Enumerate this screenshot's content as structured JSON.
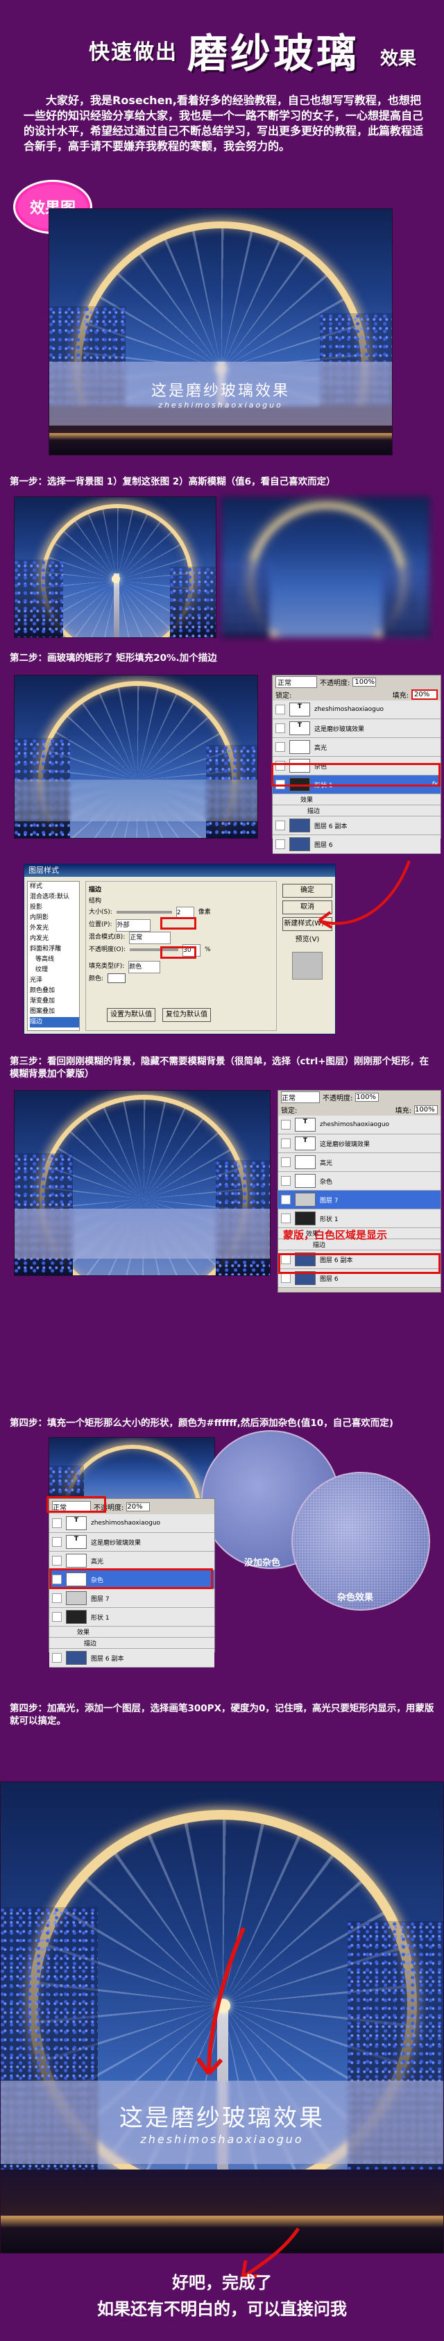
{
  "header": {
    "title_small": "快速做出",
    "title_large": "磨纱玻璃",
    "title_suffix": "效果"
  },
  "intro": "大家好，我是Rosechen,看着好多的经验教程，自己也想写写教程，也想把一些好的知识经验分享给大家，我也是一个一路不断学习的女子，一心想提高自己的设计水平，希望经过通过自己不断总结学习，写出更多更好的教程，此篇教程适合新手，高手请不要嫌弃我教程的寒颤，我会努力的。",
  "badge": "效果图",
  "glass_text": {
    "cn": "这是磨纱玻璃效果",
    "en": "zheshimoshaoxiaoguo"
  },
  "steps": {
    "s1": "第一步：选择一背景图   1）复制这张图   2）高斯模糊（值6，看自己喜欢而定）",
    "s2": "第二步：画玻璃的矩形了   矩形填充20%.加个描边",
    "s3": "第三步：看回刚刚模糊的背景，隐藏不需要模糊背景（很简单，选择（ctrl+图层）刚刚那个矩形，在模糊背景加个蒙版）",
    "s4": "第四步：填充一个矩形那么大小的形状，颜色为#ffffff,然后添加杂色(值10，自己喜欢而定)",
    "s5": "第四步：加高光，添加一个图层，选择画笔300PX，硬度为0，记住哦，高光只要矩形内显示，用蒙版就可以搞定。"
  },
  "layers_panel": {
    "blend_mode": "正常",
    "opacity_label": "不透明度:",
    "opacity_value": "100%",
    "lock_label": "锁定:",
    "fill_label": "填充:",
    "fill_value": "20%",
    "layers": [
      "zheshimoshaoxiaoguo",
      "这是磨纱玻璃效果",
      "高光",
      "杂色",
      "形状 1",
      "效果",
      "描边",
      "图层 6 副本",
      "图层 6"
    ]
  },
  "layer_style": {
    "title": "图层样式",
    "left_items": [
      "样式",
      "混合选项:默认",
      "投影",
      "内阴影",
      "外发光",
      "内发光",
      "斜面和浮雕",
      "等高线",
      "纹理",
      "光泽",
      "颜色叠加",
      "渐变叠加",
      "图案叠加",
      "描边"
    ],
    "section": "描边",
    "sub_section": "结构",
    "size_label": "大小(S):",
    "size_value": "2",
    "size_unit": "像素",
    "position_label": "位置(P):",
    "position_value": "外部",
    "blend_label": "混合模式(B):",
    "blend_value": "正常",
    "opacity_label": "不透明度(O):",
    "opacity_value": "30",
    "opacity_unit": "%",
    "fill_type_label": "填充类型(F):",
    "fill_type_value": "颜色",
    "color_label": "颜色:",
    "btn_default": "设置为默认值",
    "btn_reset": "复位为默认值",
    "buttons": [
      "确定",
      "取消",
      "新建样式(W)...",
      "预览(V)"
    ]
  },
  "step3_panel": {
    "blend_mode": "正常",
    "opacity_label": "不透明度:",
    "opacity_value": "100%",
    "lock_label": "锁定:",
    "fill_label": "填充:",
    "fill_value": "100%",
    "layers": [
      "zheshimoshaoxiaoguo",
      "这是磨纱玻璃效果",
      "高光",
      "杂色",
      "图层 7",
      "形状 1",
      "效果",
      "描边",
      "图层 6 副本",
      "图层 6"
    ],
    "annotation": "蒙版，白色区域是显示"
  },
  "step4_panel": {
    "blend_mode": "正常",
    "opacity_label": "不透明度:",
    "opacity_value": "20%",
    "layers": [
      "zheshimoshaoxiaoguo",
      "这是磨纱玻璃效果",
      "高光",
      "杂色",
      "图层 7",
      "形状 1",
      "效果",
      "描边",
      "图层 6 副本"
    ],
    "circle_left": "没加杂色",
    "circle_right": "杂色效果"
  },
  "ending": {
    "line1": "好吧，完成了",
    "line2": "如果还有不明白的，可以直接问我"
  },
  "colors": {
    "background": "#5a0e63",
    "accent_pink": "#ff44c0",
    "annotation_red": "#e01010",
    "selection_blue": "#3b6dd8"
  }
}
